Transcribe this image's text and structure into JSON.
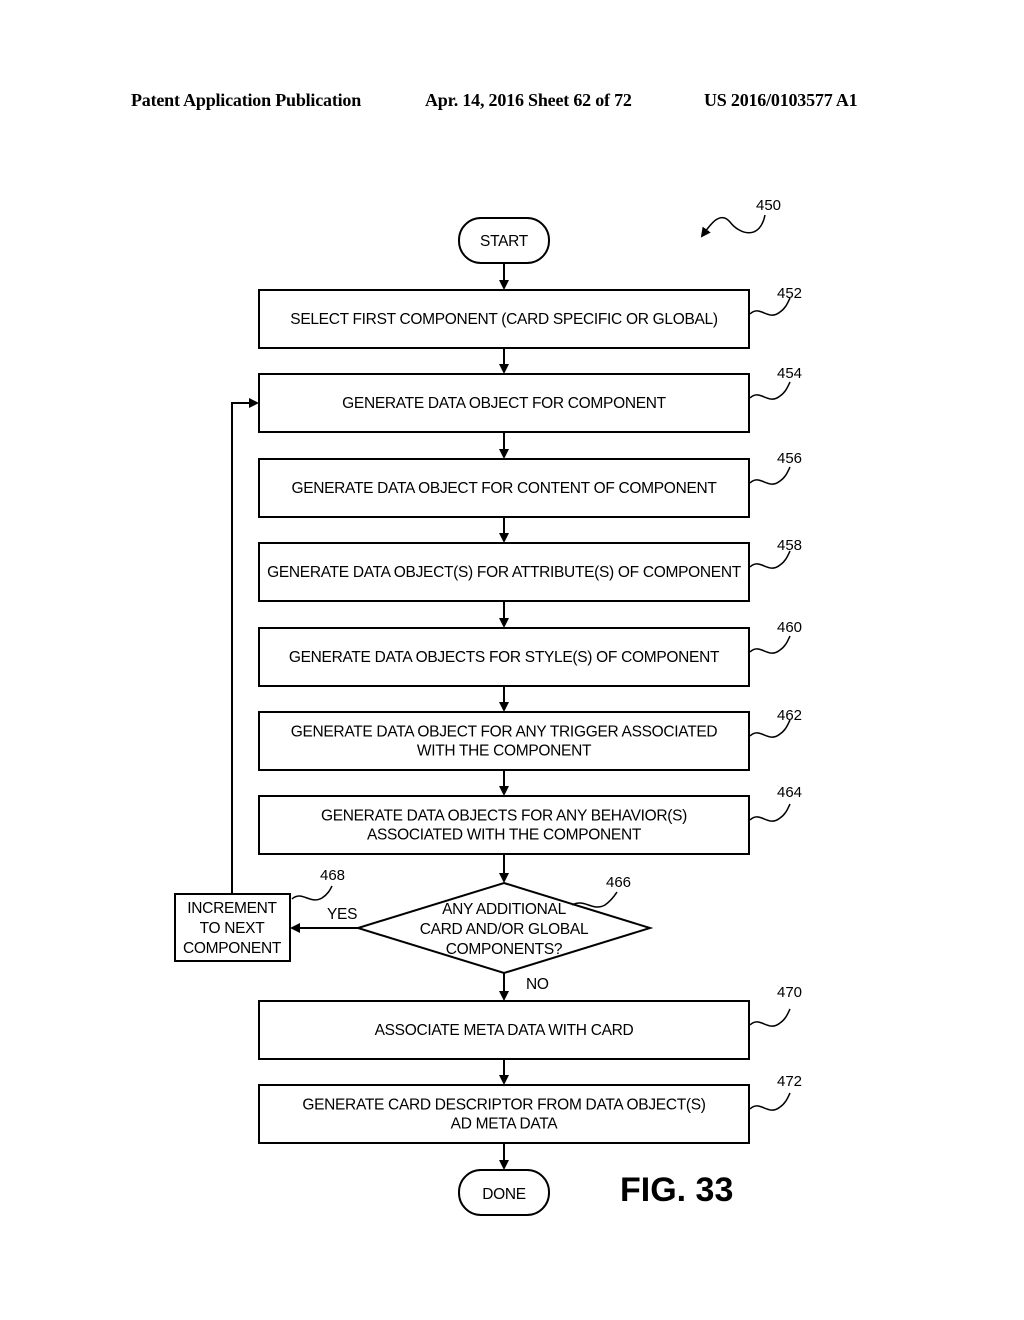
{
  "header": {
    "left": "Patent Application Publication",
    "middle": "Apr. 14, 2016  Sheet 62 of 72",
    "right": "US 2016/0103577 A1"
  },
  "figure": {
    "label": "FIG. 33",
    "ref": "450"
  },
  "terminals": {
    "start": "START",
    "done": "DONE"
  },
  "steps": [
    {
      "ref": "452",
      "lines": [
        "SELECT FIRST COMPONENT (CARD SPECIFIC OR GLOBAL)"
      ]
    },
    {
      "ref": "454",
      "lines": [
        "GENERATE DATA OBJECT FOR COMPONENT"
      ]
    },
    {
      "ref": "456",
      "lines": [
        "GENERATE DATA OBJECT FOR CONTENT OF COMPONENT"
      ]
    },
    {
      "ref": "458",
      "lines": [
        "GENERATE DATA OBJECT(S) FOR ATTRIBUTE(S) OF COMPONENT"
      ]
    },
    {
      "ref": "460",
      "lines": [
        "GENERATE DATA OBJECTS FOR STYLE(S) OF COMPONENT"
      ]
    },
    {
      "ref": "462",
      "lines": [
        "GENERATE DATA OBJECT FOR ANY TRIGGER ASSOCIATED",
        "WITH THE COMPONENT"
      ]
    },
    {
      "ref": "464",
      "lines": [
        "GENERATE DATA OBJECTS FOR ANY BEHAVIOR(S)",
        "ASSOCIATED WITH THE COMPONENT"
      ]
    },
    {
      "ref": "470",
      "lines": [
        "ASSOCIATE META DATA WITH CARD"
      ]
    },
    {
      "ref": "472",
      "lines": [
        "GENERATE CARD DESCRIPTOR FROM DATA OBJECT(S)",
        "AD META DATA"
      ]
    }
  ],
  "decision": {
    "ref": "466",
    "lines": [
      "ANY ADDITIONAL",
      "CARD AND/OR GLOBAL",
      "COMPONENTS?"
    ],
    "yes_label": "YES",
    "no_label": "NO"
  },
  "increment": {
    "ref": "468",
    "lines": [
      "INCREMENT",
      "TO NEXT",
      "COMPONENT"
    ]
  }
}
